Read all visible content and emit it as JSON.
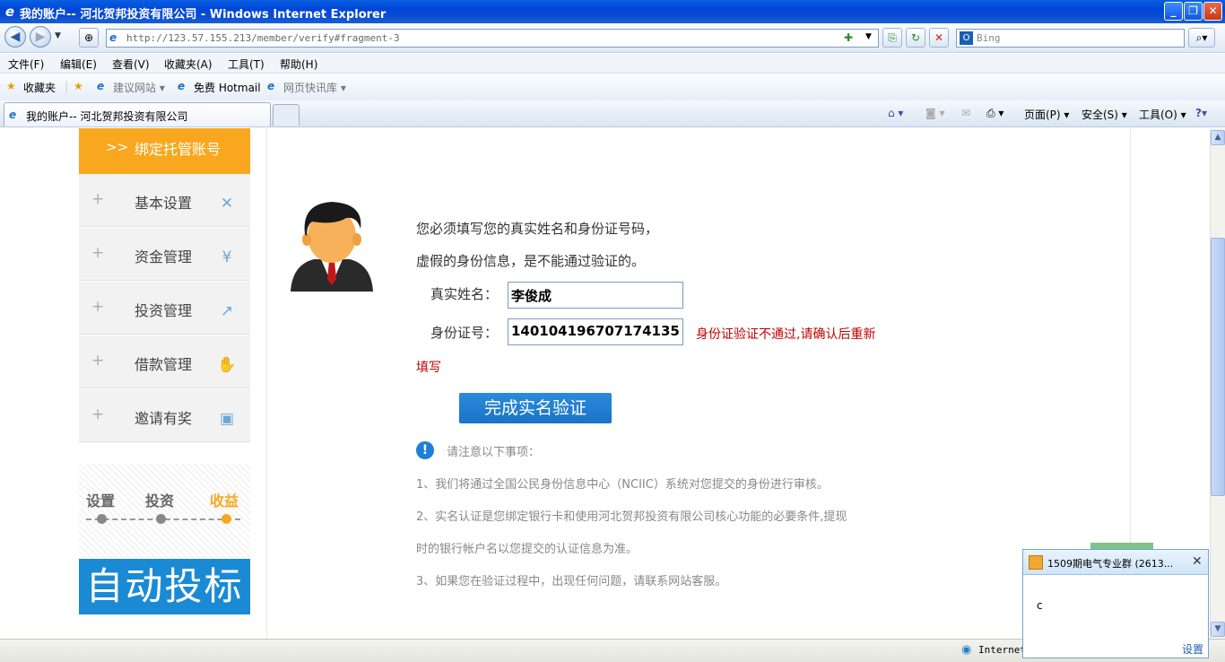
{
  "window": {
    "title": "我的账户-- 河北贺邦投资有限公司 - Windows Internet Explorer",
    "min_label": "_",
    "max_label": "❐",
    "close_label": "✕"
  },
  "address_bar": {
    "back_label": "◀",
    "forward_label": "▶",
    "url": "http://123.57.155.213/member/verify#fragment-3",
    "search_placeholder": "Bing"
  },
  "menu": [
    "文件(F)",
    "编辑(E)",
    "查看(V)",
    "收藏夹(A)",
    "工具(T)",
    "帮助(H)"
  ],
  "favorites_bar": {
    "favorites": "收藏夹",
    "suggested_sites": "建议网站 ▾",
    "free_hotmail": "免费 Hotmail",
    "web_slice": "网页快讯库 ▾"
  },
  "tab": {
    "title": "我的账户-- 河北贺邦投资有限公司"
  },
  "command_bar": {
    "page": "页面(P) ▾",
    "safety": "安全(S) ▾",
    "tools": "工具(O) ▾",
    "help": "?▾"
  },
  "sidebar": {
    "active": {
      "arrow": ">>",
      "label": "绑定托管账号"
    },
    "items": [
      {
        "label": "基本设置",
        "icon": "tools-icon",
        "glyph": "✕"
      },
      {
        "label": "资金管理",
        "icon": "yen-icon",
        "glyph": "¥"
      },
      {
        "label": "投资管理",
        "icon": "chart-icon",
        "glyph": "↗"
      },
      {
        "label": "借款管理",
        "icon": "hand-icon",
        "glyph": "✋"
      },
      {
        "label": "邀请有奖",
        "icon": "gift-icon",
        "glyph": "▣"
      }
    ],
    "plus": "+"
  },
  "promo": {
    "steps": [
      "设置",
      "投资",
      "收益"
    ],
    "banner": "自动投标",
    "accent_color": "#f8a71f",
    "banner_color": "#1b8ad4"
  },
  "form": {
    "intro_line1": "您必须填写您的真实姓名和身份证号码，",
    "intro_line2": "虚假的身份信息，是不能通过验证的。",
    "name_label": "真实姓名：",
    "name_value": "李俊成",
    "id_label": "身份证号：",
    "id_value": "140104196707174135",
    "error_line1": "身份证验证不通过,请确认后重新",
    "error_line2": "填写",
    "submit_label": "完成实名验证"
  },
  "notes": {
    "heading": "请注意以下事项：",
    "item1": "1、我们将通过全国公民身份信息中心（NCIIC）系统对您提交的身份进行审核。",
    "item2a": "2、实名认证是您绑定银行卡和使用河北贺邦投资有限公司核心功能的必要条件,提现",
    "item2b": "时的银行帐户名以您提交的认证信息为准。",
    "item3": "3、如果您在验证过程中，出现任何问题，请联系网站客服。"
  },
  "status_bar": {
    "zone": "Internet"
  },
  "qq_popup": {
    "title": "1509期电气专业群 (2613...",
    "message": "c",
    "settings": "设置"
  }
}
